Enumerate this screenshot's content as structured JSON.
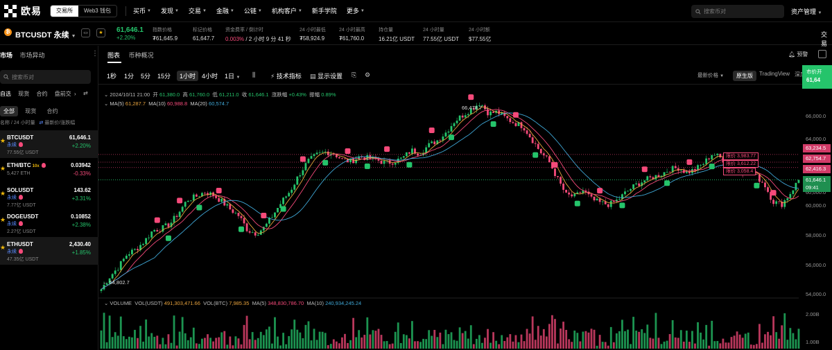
{
  "nav": {
    "logo": "欧易",
    "mode_exchange": "交易所",
    "mode_web3": "Web3 钱包",
    "items": [
      "买币",
      "发现",
      "交易",
      "金融",
      "公链",
      "机构客户",
      "新手学院",
      "更多"
    ],
    "search_placeholder": "搜索币对",
    "asset_mgmt": "资产管理"
  },
  "ticker": {
    "pair": "BTCUSDT 永续",
    "price": "61,646.1",
    "change": "+2.20%",
    "stats": [
      {
        "label": "指数价格",
        "value": "₮61,645.9"
      },
      {
        "label": "标记价格",
        "value": "61,647.7"
      },
      {
        "label": "资金费率 / 倒计时",
        "value_red": "0.003%",
        "value_rest": " / 2 小时 9 分 41 秒"
      },
      {
        "label": "24 小时最低",
        "value": "₮58,924.9"
      },
      {
        "label": "24 小时最高",
        "value": "₮61,760.0"
      },
      {
        "label": "持仓量",
        "value": "16.21亿 USDT"
      },
      {
        "label": "24 小时量",
        "value": "77.55亿 USDT"
      },
      {
        "label": "24 小时额",
        "value": "$77.55亿"
      }
    ],
    "trade_label": "交易"
  },
  "sidebar": {
    "tab_market": "市场",
    "tab_movers": "市场异动",
    "search_placeholder": "搜索币对",
    "filters": [
      "自选",
      "现货",
      "合约",
      "盘前交"
    ],
    "subtabs": [
      "全部",
      "现货",
      "合约"
    ],
    "sort_name": "名称 / 24 小时量",
    "sort_price": "最新价/涨跌幅",
    "coins": [
      {
        "name": "BTCUSDT",
        "tag": "永续",
        "vol": "77.55亿 USDT",
        "price": "61,646.1",
        "change": "+2.20%",
        "dir": "up",
        "lev": ""
      },
      {
        "name": "ETH/BTC",
        "tag": "",
        "vol": "5,427 ETH",
        "price": "0.03942",
        "change": "-0.33%",
        "dir": "down",
        "lev": "10x"
      },
      {
        "name": "SOLUSDT",
        "tag": "永续",
        "vol": "7.77亿 USDT",
        "price": "143.62",
        "change": "+3.31%",
        "dir": "up",
        "lev": ""
      },
      {
        "name": "DOGEUSDT",
        "tag": "永续",
        "vol": "2.27亿 USDT",
        "price": "0.10852",
        "change": "+2.38%",
        "dir": "up",
        "lev": ""
      },
      {
        "name": "ETHUSDT",
        "tag": "永续",
        "vol": "47.35亿 USDT",
        "price": "2,430.40",
        "change": "+1.85%",
        "dir": "up",
        "lev": ""
      }
    ]
  },
  "chart_tabs": [
    "图表",
    "币种概况"
  ],
  "alert_label": "预警",
  "timeframes": [
    "1秒",
    "1分",
    "5分",
    "15分",
    "1小时",
    "4小时",
    "1日"
  ],
  "tools": {
    "indicators": "技术指标",
    "display": "显示设置"
  },
  "price_type": "最新价格",
  "views": [
    "原生版",
    "TradingView",
    "深度"
  ],
  "market_btn": {
    "line1": "市价开",
    "line2": "61,64"
  },
  "ohlc": {
    "date": "2024/10/11 21:00",
    "open_l": "开",
    "open": "61,380.0",
    "high_l": "高",
    "high": "61,760.0",
    "low_l": "低",
    "low": "61,211.0",
    "close_l": "收",
    "close": "61,646.1",
    "chg_l": "涨跌幅",
    "chg": "+0.43%",
    "amp_l": "振幅",
    "amp": "0.89%"
  },
  "ma": {
    "ma5_l": "MA(5)",
    "ma5": "61,287.7",
    "ma10_l": "MA(10)",
    "ma10": "60,988.8",
    "ma20_l": "MA(20)",
    "ma20": "60,574.7"
  },
  "volume": {
    "label": "VOLUME",
    "vusdt_l": "VOL(USDT)",
    "vusdt": "491,303,471.66",
    "vbtc_l": "VOL(BTC)",
    "vbtc": "7,985.35",
    "ma5_l": "MA(5)",
    "ma5": "348,830,786.70",
    "ma10_l": "MA(10)",
    "ma10": "240,934,245.24"
  },
  "y_labels": [
    "66,000.0",
    "64,000.0",
    "62,000.0",
    "60,000.0",
    "58,000.0",
    "56,000.0",
    "54,000.0"
  ],
  "vol_labels": [
    "2.00B",
    "1.00B"
  ],
  "price_tags": [
    {
      "value": "63,234.5",
      "color": "#f54a7a"
    },
    {
      "value": "62,754.7",
      "color": "#f54a7a"
    },
    {
      "value": "62,416.3",
      "color": "#f54a7a"
    },
    {
      "value": "61,646.1",
      "color": "#25a85e"
    },
    {
      "value": "09:41",
      "color": "#25a85e"
    }
  ],
  "limit_orders": [
    {
      "label": "限价",
      "value": "3,983.77"
    },
    {
      "label": "限价",
      "value": "3,612.22"
    },
    {
      "label": "限价",
      "value": "3,058.4"
    }
  ],
  "high_marker": "66,478.7",
  "low_marker": "54,802.7",
  "chart_data": {
    "type": "candlestick",
    "interval": "1小时",
    "ylim": [
      54000,
      67000
    ],
    "close_path": [
      54802.7,
      55600,
      56200,
      57000,
      57300,
      57800,
      58500,
      58600,
      58900,
      59600,
      60400,
      60600,
      60900,
      60700,
      60300,
      59800,
      59400,
      58500,
      58300,
      58700,
      59500,
      60300,
      61000,
      62000,
      62800,
      63200,
      63400,
      63300,
      62900,
      62800,
      63100,
      63000,
      62900,
      62700,
      62800,
      63000,
      63500,
      63300,
      63800,
      64100,
      64600,
      65300,
      65700,
      66100,
      66478.7,
      65800,
      65900,
      65500,
      65200,
      65000,
      64200,
      63400,
      62800,
      61700,
      60700,
      60600,
      61000,
      60400,
      60200,
      60100,
      60400,
      60900,
      61300,
      61600,
      61800,
      62000,
      62300,
      62400,
      62100,
      62300,
      62700,
      63300,
      63000,
      62500,
      62100,
      62300,
      61900,
      61400,
      60300,
      60100,
      60800,
      61646.1
    ],
    "volume_max": 2000000000
  }
}
